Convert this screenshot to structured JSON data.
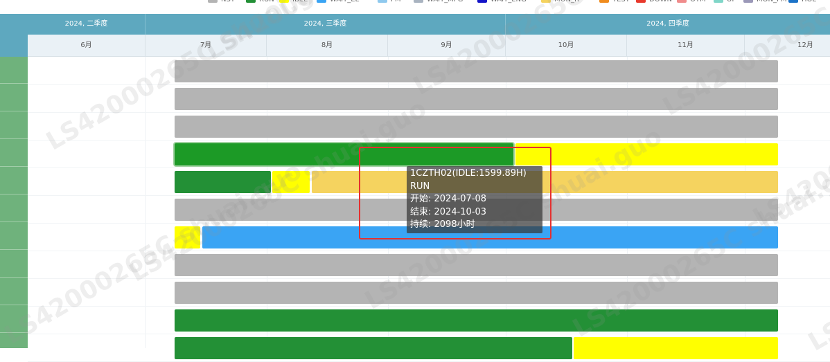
{
  "legend": [
    {
      "label": "NST",
      "color": "#b4b4b4"
    },
    {
      "label": "RUN",
      "color": "#239036"
    },
    {
      "label": "IDLE",
      "color": "#ffff00"
    },
    {
      "label": "WAIT_EE",
      "color": "#3aa4f4"
    },
    {
      "label": "PM",
      "color": "#8fc9ee"
    },
    {
      "label": "WAIT_MFG",
      "color": "#a9b3c0"
    },
    {
      "label": "WAIT_ENG",
      "color": "#1414c8"
    },
    {
      "label": "MON_R",
      "color": "#f5d35f"
    },
    {
      "label": "TEST",
      "color": "#f08c1e"
    },
    {
      "label": "DOWN",
      "color": "#e8392c"
    },
    {
      "label": "OTM",
      "color": "#f08c8c"
    },
    {
      "label": "UP",
      "color": "#80d6c8"
    },
    {
      "label": "MON_PM",
      "color": "#9b98b8"
    },
    {
      "label": "HOL",
      "color": "#1c73c8"
    }
  ],
  "timeline": {
    "quarters": [
      "2024, 二季度",
      "2024, 三季度",
      "2024, 四季度"
    ],
    "months": [
      "6月",
      "7月",
      "8月",
      "9月",
      "10月",
      "11月",
      "12月"
    ]
  },
  "rows": [
    {
      "segments": [
        {
          "state": "NST",
          "color": "#b4b4b4",
          "start": "2024-07-08",
          "end": "2024-12-12"
        }
      ]
    },
    {
      "segments": [
        {
          "state": "NST",
          "color": "#b4b4b4",
          "start": "2024-07-08",
          "end": "2024-12-12"
        }
      ]
    },
    {
      "segments": [
        {
          "state": "NST",
          "color": "#b4b4b4",
          "start": "2024-07-08",
          "end": "2024-12-12"
        }
      ]
    },
    {
      "segments": [
        {
          "state": "RUN",
          "color": "#1c9a26",
          "start": "2024-07-08",
          "end": "2024-10-03",
          "highlighted": true
        },
        {
          "state": "IDLE",
          "color": "#ffff00",
          "start": "2024-10-03",
          "end": "2024-12-12"
        }
      ]
    },
    {
      "segments": [
        {
          "state": "RUN",
          "color": "#239036",
          "start": "2024-07-08",
          "end": "2024-08-02"
        },
        {
          "state": "IDLE",
          "color": "#ffff00",
          "start": "2024-08-02",
          "end": "2024-08-12"
        },
        {
          "state": "MON_R",
          "color": "#f5d35f",
          "start": "2024-08-12",
          "end": "2024-12-12"
        }
      ]
    },
    {
      "segments": [
        {
          "state": "NST",
          "color": "#b4b4b4",
          "start": "2024-07-08",
          "end": "2024-12-12"
        }
      ]
    },
    {
      "segments": [
        {
          "state": "IDLE",
          "color": "#ffff00",
          "start": "2024-07-08",
          "end": "2024-07-15"
        },
        {
          "state": "WAIT_EE",
          "color": "#3aa4f4",
          "start": "2024-07-15",
          "end": "2024-12-12"
        }
      ]
    },
    {
      "segments": [
        {
          "state": "NST",
          "color": "#b4b4b4",
          "start": "2024-07-08",
          "end": "2024-12-12"
        }
      ]
    },
    {
      "segments": [
        {
          "state": "NST",
          "color": "#b4b4b4",
          "start": "2024-07-08",
          "end": "2024-12-12"
        }
      ]
    },
    {
      "segments": [
        {
          "state": "RUN",
          "color": "#239036",
          "start": "2024-07-08",
          "end": "2024-12-12"
        }
      ]
    },
    {
      "segments": [
        {
          "state": "RUN",
          "color": "#239036",
          "start": "2024-07-08",
          "end": "2024-10-18"
        },
        {
          "state": "IDLE",
          "color": "#ffff00",
          "start": "2024-10-18",
          "end": "2024-12-12"
        }
      ]
    }
  ],
  "tooltip": {
    "title": "1CZTH02(IDLE:1599.89H)",
    "state": "RUN",
    "start_line": "开始: 2024-07-08",
    "end_line": "结束: 2024-10-03",
    "duration_line": "持续: 2098小时"
  },
  "watermark": {
    "text": "LS42000265C shuai.guo"
  }
}
